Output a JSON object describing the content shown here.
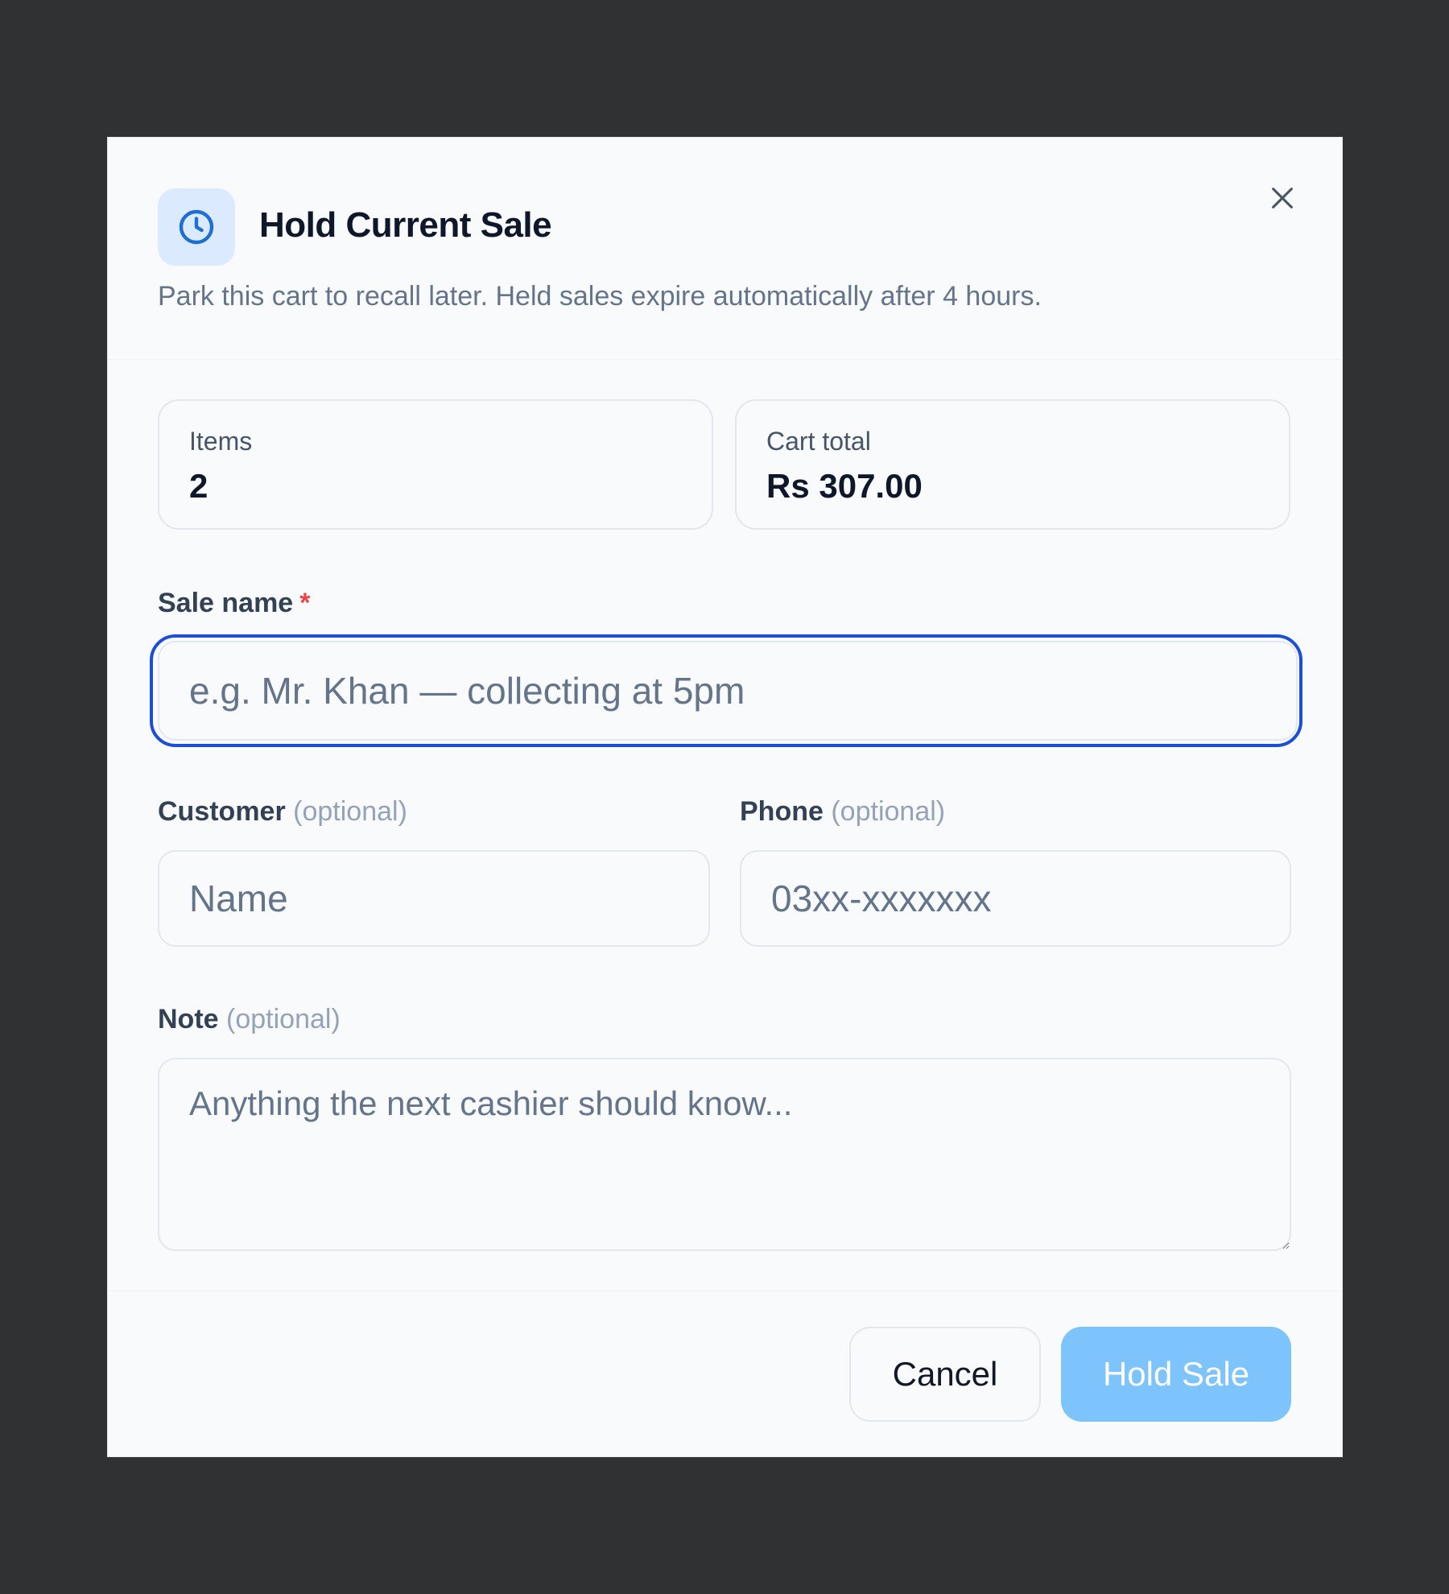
{
  "dialog": {
    "title": "Hold Current Sale",
    "subtitle": "Park this cart to recall later. Held sales expire automatically after 4 hours.",
    "icon": "clock-icon",
    "close_icon": "close-icon"
  },
  "summary": {
    "items_label": "Items",
    "items_value": "2",
    "total_label": "Cart total",
    "total_value": "Rs 307.00"
  },
  "form": {
    "sale_name": {
      "label": "Sale name",
      "required_marker": "*",
      "value": "",
      "placeholder": "e.g. Mr. Khan — collecting at 5pm"
    },
    "customer": {
      "label": "Customer",
      "optional": "(optional)",
      "value": "",
      "placeholder": "Name"
    },
    "phone": {
      "label": "Phone",
      "optional": "(optional)",
      "value": "",
      "placeholder": "03xx-xxxxxxx"
    },
    "note": {
      "label": "Note",
      "optional": "(optional)",
      "value": "",
      "placeholder": "Anything the next cashier should know..."
    }
  },
  "actions": {
    "cancel_label": "Cancel",
    "hold_label": "Hold Sale"
  },
  "colors": {
    "accent": "#1d4ed8",
    "primary_button_disabled": "#7cc4fb",
    "required": "#ef4444"
  }
}
